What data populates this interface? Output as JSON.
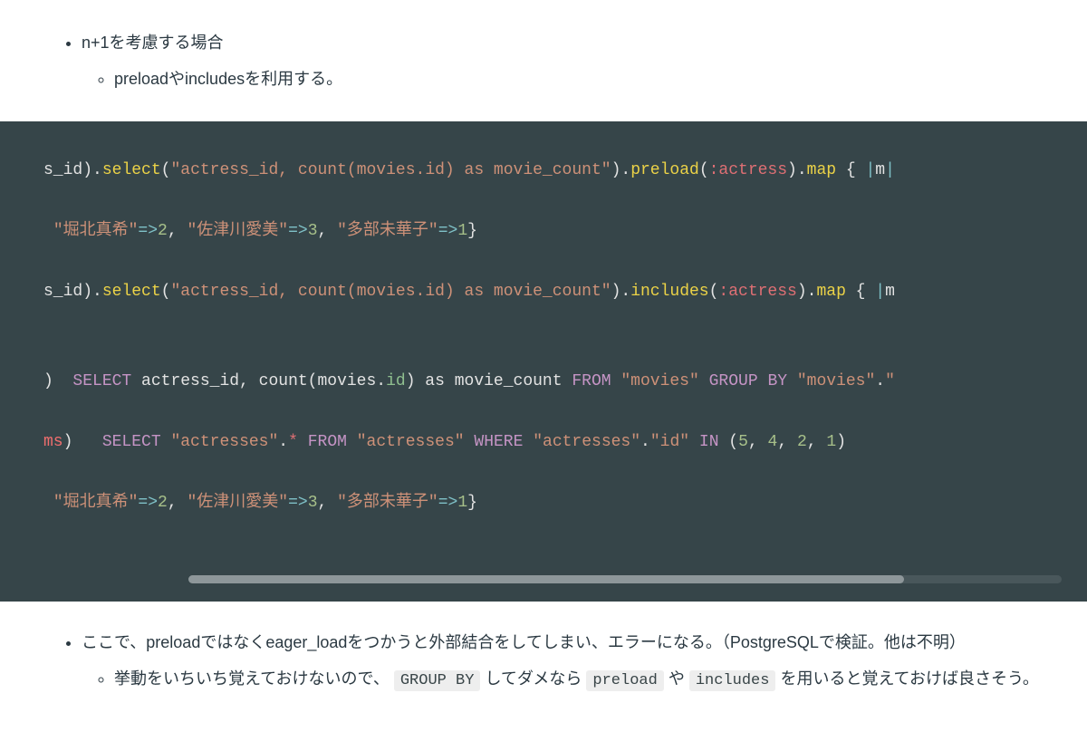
{
  "top_list": {
    "item1": "n+1を考慮する場合",
    "item1_sub1": "preloadやincludesを利用する。"
  },
  "code": {
    "l1": {
      "a": "s_id",
      "b": ")",
      "c": ".",
      "d": "select",
      "e": "(",
      "f": "\"actress_id, count(movies.id) as movie_count\"",
      "g": ")",
      "h": ".",
      "i": "preload",
      "j": "(",
      "k": ":actress",
      "l": ")",
      "m": ".",
      "n": "map",
      "o": " { ",
      "p": "|",
      "q": "m",
      "r": "|"
    },
    "l2": {
      "a": " ",
      "b": "\"堀北真希\"",
      "c": "=>",
      "d": "2",
      "e": ",",
      "f": " ",
      "g": "\"佐津川愛美\"",
      "h": "=>",
      "i": "3",
      "j": ",",
      "k": " ",
      "l": "\"多部未華子\"",
      "m": "=>",
      "n": "1",
      "o": "}"
    },
    "l3": {
      "a": "s_id",
      "b": ")",
      "c": ".",
      "d": "select",
      "e": "(",
      "f": "\"actress_id, count(movies.id) as movie_count\"",
      "g": ")",
      "h": ".",
      "i": "includes",
      "j": "(",
      "k": ":actress",
      "l": ")",
      "m": ".",
      "n": "map",
      "o": " { ",
      "p": "|",
      "q": "m"
    },
    "l4": {
      "a": ")",
      "b": "  ",
      "c": "SELECT",
      "d": " actress_id, count(movies",
      "e": ".",
      "f": "id",
      "g": ") as movie_count ",
      "h": "FROM",
      "i": " ",
      "j": "\"movies\"",
      "k": " ",
      "l": "GROUP",
      "m": " ",
      "n": "BY",
      "o": " ",
      "p": "\"movies\"",
      "q": ".",
      "r": "\""
    },
    "l5": {
      "a": "ms",
      "b": ")",
      "c": "   ",
      "d": "SELECT",
      "e": " ",
      "f": "\"actresses\"",
      "g": ".",
      "h": "*",
      "i": " ",
      "j": "FROM",
      "k": " ",
      "l": "\"actresses\"",
      "m": " ",
      "n": "WHERE",
      "o": " ",
      "p": "\"actresses\"",
      "q": ".",
      "r": "\"id\"",
      "s": " ",
      "t": "IN",
      "u": " (",
      "v": "5",
      "w": ", ",
      "x": "4",
      "y": ", ",
      "z": "2",
      "aa": ", ",
      "ab": "1",
      "ac": ")"
    },
    "l6": {
      "a": " ",
      "b": "\"堀北真希\"",
      "c": "=>",
      "d": "2",
      "e": ",",
      "f": " ",
      "g": "\"佐津川愛美\"",
      "h": "=>",
      "i": "3",
      "j": ",",
      "k": " ",
      "l": "\"多部未華子\"",
      "m": "=>",
      "n": "1",
      "o": "}"
    }
  },
  "bottom_list": {
    "item1_a": "ここで、preloadではなくeager_loadをつかうと外部結合をしてしまい、エラーになる。（PostgreSQLで検証。他は不明）",
    "item1_sub1_a": "挙動をいちいち覚えておけないので、 ",
    "item1_sub1_code1": "GROUP BY",
    "item1_sub1_b": " してダメなら ",
    "item1_sub1_code2": "preload",
    "item1_sub1_c": " や ",
    "item1_sub1_code3": "includes",
    "item1_sub1_d": " を用いると覚えておけば良さそう。"
  }
}
